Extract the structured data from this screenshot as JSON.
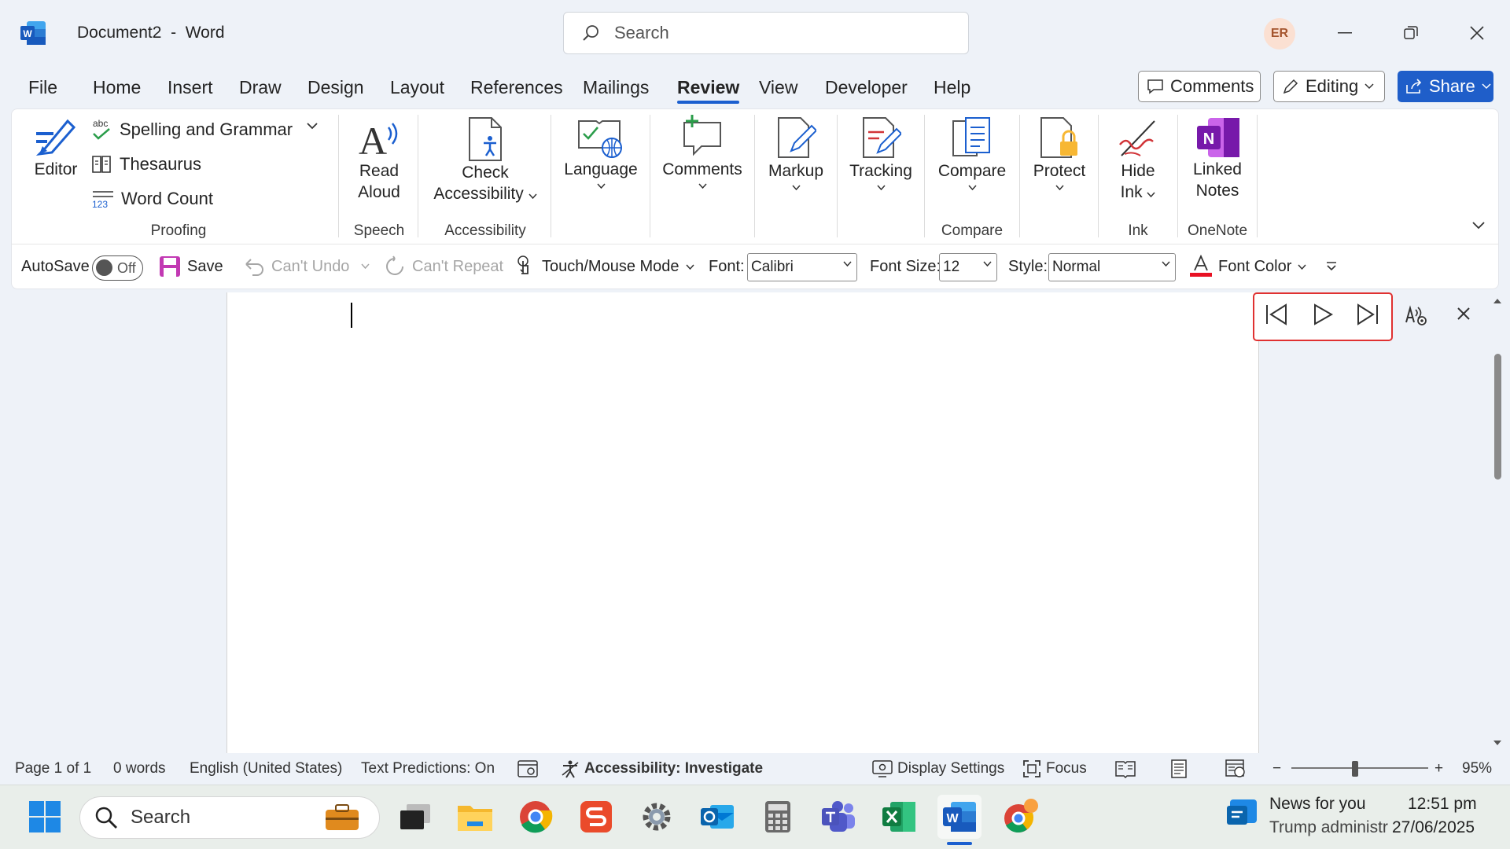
{
  "titlebar": {
    "doc_name": "Document2",
    "separator": "-",
    "app_name": "Word",
    "search_placeholder": "Search",
    "avatar_initials": "ER"
  },
  "tabs": [
    "File",
    "Home",
    "Insert",
    "Draw",
    "Design",
    "Layout",
    "References",
    "Mailings",
    "Review",
    "View",
    "Developer",
    "Help"
  ],
  "active_tab": "Review",
  "top_buttons": {
    "comments": "Comments",
    "editing": "Editing",
    "share": "Share"
  },
  "ribbon": {
    "editor": "Editor",
    "spelling": "Spelling and Grammar",
    "thesaurus": "Thesaurus",
    "word_count": "Word Count",
    "proofing": "Proofing",
    "read": "Read",
    "aloud": "Aloud",
    "speech": "Speech",
    "check": "Check",
    "accessibility_btn": "Accessibility",
    "accessibility": "Accessibility",
    "language": "Language",
    "comments": "Comments",
    "markup": "Markup",
    "tracking": "Tracking",
    "compare_btn": "Compare",
    "compare": "Compare",
    "protect": "Protect",
    "hide": "Hide",
    "ink_btn": "Ink",
    "ink": "Ink",
    "linked": "Linked",
    "notes": "Notes",
    "onenote": "OneNote"
  },
  "qat": {
    "autosave": "AutoSave",
    "toggle": "Off",
    "save": "Save",
    "undo": "Can't Undo",
    "repeat": "Can't Repeat",
    "touch": "Touch/Mouse Mode",
    "font_label": "Font:",
    "font_value": "Calibri",
    "size_label": "Font Size:",
    "size_value": "12",
    "style_label": "Style:",
    "style_value": "Normal",
    "font_color": "Font Color"
  },
  "status": {
    "page": "Page 1 of 1",
    "words": "0 words",
    "language": "English (United States)",
    "predictions": "Text Predictions: On",
    "accessibility": "Accessibility: Investigate",
    "display": "Display Settings",
    "focus": "Focus",
    "zoom": "95%"
  },
  "taskbar": {
    "search": "Search",
    "news_title": "News for you",
    "news_sub": "Trump administr",
    "time": "12:51 pm",
    "date": "27/06/2025"
  },
  "colors": {
    "accent": "#1b5fcf",
    "share": "#1f5ec9",
    "highlight": "#e03131"
  }
}
